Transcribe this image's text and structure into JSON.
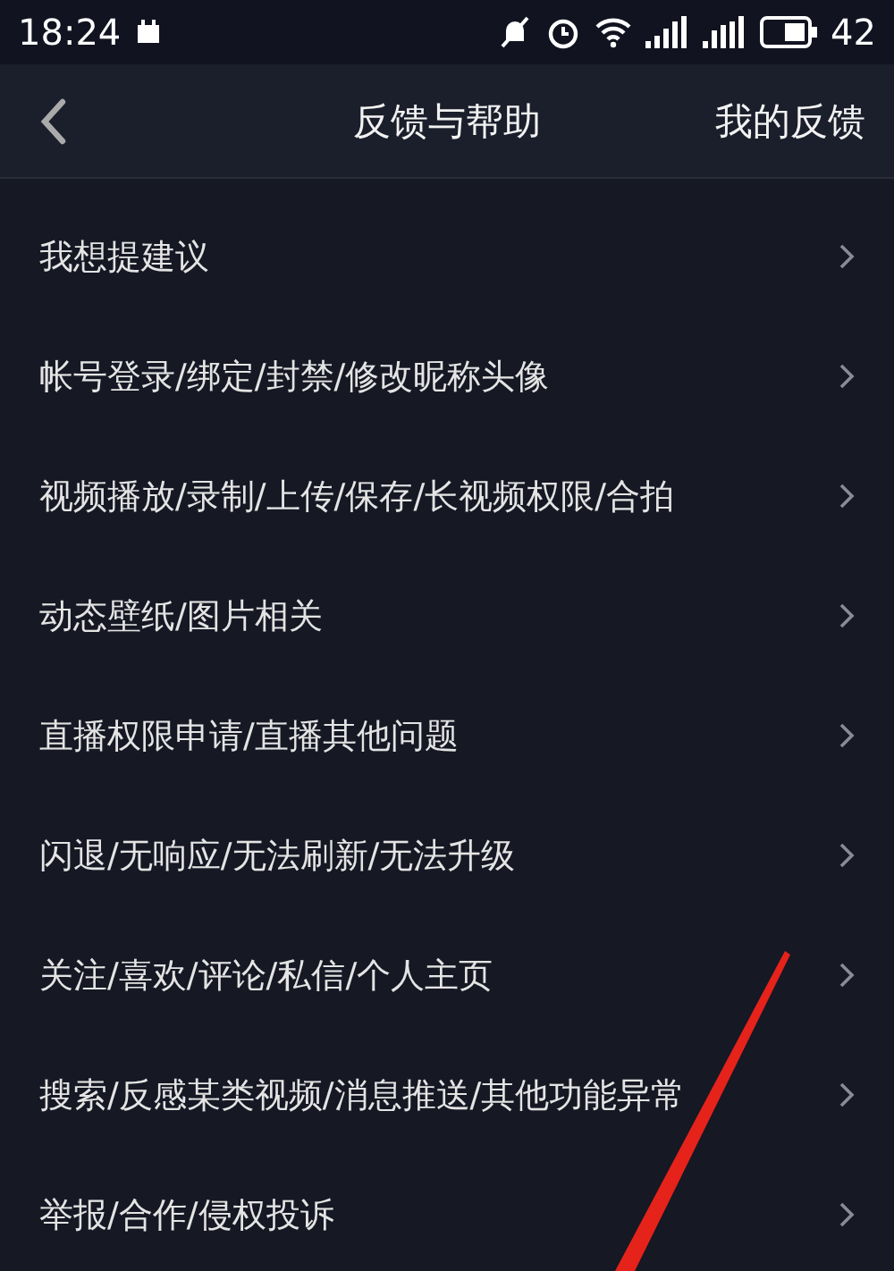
{
  "status_bar": {
    "time": "18:24",
    "battery": "42"
  },
  "header": {
    "title": "反馈与帮助",
    "action": "我的反馈"
  },
  "items": [
    "我想提建议",
    "帐号登录/绑定/封禁/修改昵称头像",
    "视频播放/录制/上传/保存/长视频权限/合拍",
    "动态壁纸/图片相关",
    "直播权限申请/直播其他问题",
    "闪退/无响应/无法刷新/无法升级",
    "关注/喜欢/评论/私信/个人主页",
    "搜索/反感某类视频/消息推送/其他功能异常",
    "举报/合作/侵权投诉"
  ]
}
